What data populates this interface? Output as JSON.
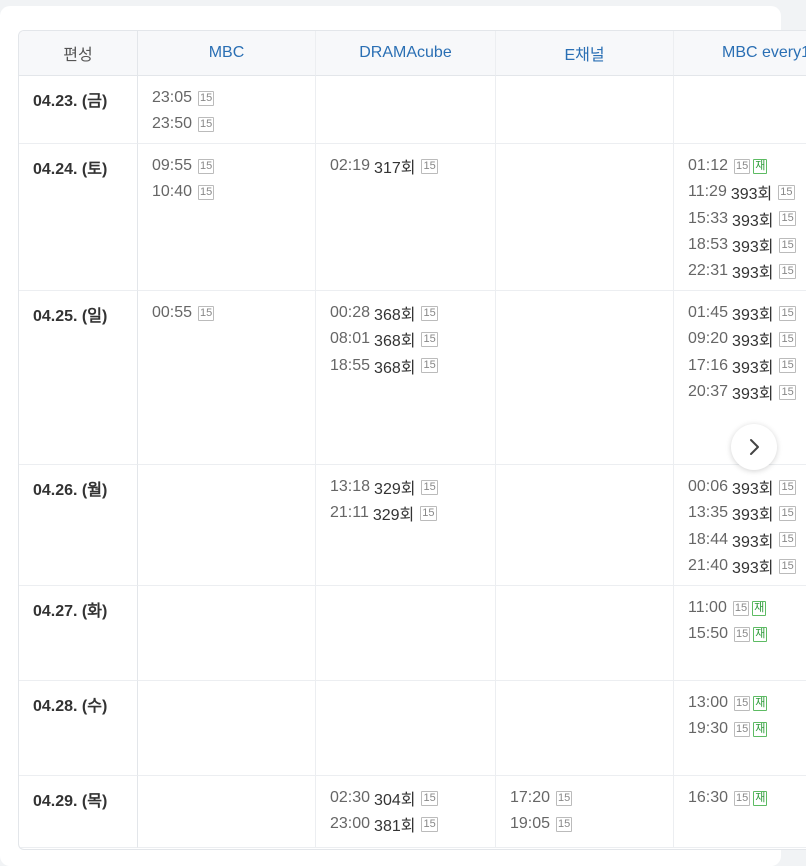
{
  "header": {
    "corner": "편성",
    "channels": [
      "MBC",
      "DRAMAcube",
      "E채널",
      "MBC every1"
    ]
  },
  "rows": [
    {
      "date": "04.23. (금)",
      "cols": [
        [
          {
            "time": "23:05",
            "ep": "",
            "badge": "15",
            "re": ""
          },
          {
            "time": "23:50",
            "ep": "",
            "badge": "15",
            "re": ""
          }
        ],
        [],
        [],
        []
      ]
    },
    {
      "date": "04.24. (토)",
      "cols": [
        [
          {
            "time": "09:55",
            "ep": "",
            "badge": "15",
            "re": ""
          },
          {
            "time": "10:40",
            "ep": "",
            "badge": "15",
            "re": ""
          }
        ],
        [
          {
            "time": "02:19",
            "ep": "317회",
            "badge": "15",
            "re": ""
          }
        ],
        [],
        [
          {
            "time": "01:12",
            "ep": "",
            "badge": "15",
            "re": "재"
          },
          {
            "time": "11:29",
            "ep": "393회",
            "badge": "15",
            "re": ""
          },
          {
            "time": "15:33",
            "ep": "393회",
            "badge": "15",
            "re": ""
          },
          {
            "time": "18:53",
            "ep": "393회",
            "badge": "15",
            "re": ""
          },
          {
            "time": "22:31",
            "ep": "393회",
            "badge": "15",
            "re": ""
          }
        ]
      ]
    },
    {
      "date": "04.25. (일)",
      "cols": [
        [
          {
            "time": "00:55",
            "ep": "",
            "badge": "15",
            "re": ""
          }
        ],
        [
          {
            "time": "00:28",
            "ep": "368회",
            "badge": "15",
            "re": ""
          },
          {
            "time": "08:01",
            "ep": "368회",
            "badge": "15",
            "re": ""
          },
          {
            "time": "18:55",
            "ep": "368회",
            "badge": "15",
            "re": ""
          }
        ],
        [],
        [
          {
            "time": "01:45",
            "ep": "393회",
            "badge": "15",
            "re": ""
          },
          {
            "time": "09:20",
            "ep": "393회",
            "badge": "15",
            "re": ""
          },
          {
            "time": "17:16",
            "ep": "393회",
            "badge": "15",
            "re": ""
          },
          {
            "time": "20:37",
            "ep": "393회",
            "badge": "15",
            "re": ""
          }
        ]
      ]
    },
    {
      "date": "04.26. (월)",
      "cols": [
        [],
        [
          {
            "time": "13:18",
            "ep": "329회",
            "badge": "15",
            "re": ""
          },
          {
            "time": "21:11",
            "ep": "329회",
            "badge": "15",
            "re": ""
          }
        ],
        [],
        [
          {
            "time": "00:06",
            "ep": "393회",
            "badge": "15",
            "re": ""
          },
          {
            "time": "13:35",
            "ep": "393회",
            "badge": "15",
            "re": ""
          },
          {
            "time": "18:44",
            "ep": "393회",
            "badge": "15",
            "re": ""
          },
          {
            "time": "21:40",
            "ep": "393회",
            "badge": "15",
            "re": ""
          }
        ]
      ]
    },
    {
      "date": "04.27. (화)",
      "cols": [
        [],
        [],
        [],
        [
          {
            "time": "11:00",
            "ep": "",
            "badge": "15",
            "re": "재"
          },
          {
            "time": "15:50",
            "ep": "",
            "badge": "15",
            "re": "재"
          }
        ]
      ]
    },
    {
      "date": "04.28. (수)",
      "cols": [
        [],
        [],
        [],
        [
          {
            "time": "13:00",
            "ep": "",
            "badge": "15",
            "re": "재"
          },
          {
            "time": "19:30",
            "ep": "",
            "badge": "15",
            "re": "재"
          }
        ]
      ]
    },
    {
      "date": "04.29. (목)",
      "cols": [
        [],
        [
          {
            "time": "02:30",
            "ep": "304회",
            "badge": "15",
            "re": ""
          },
          {
            "time": "23:00",
            "ep": "381회",
            "badge": "15",
            "re": ""
          }
        ],
        [
          {
            "time": "17:20",
            "ep": "",
            "badge": "15",
            "re": ""
          },
          {
            "time": "19:05",
            "ep": "",
            "badge": "15",
            "re": ""
          }
        ],
        [
          {
            "time": "16:30",
            "ep": "",
            "badge": "15",
            "re": "재"
          }
        ]
      ]
    }
  ],
  "next_icon": "chevron-right-icon"
}
